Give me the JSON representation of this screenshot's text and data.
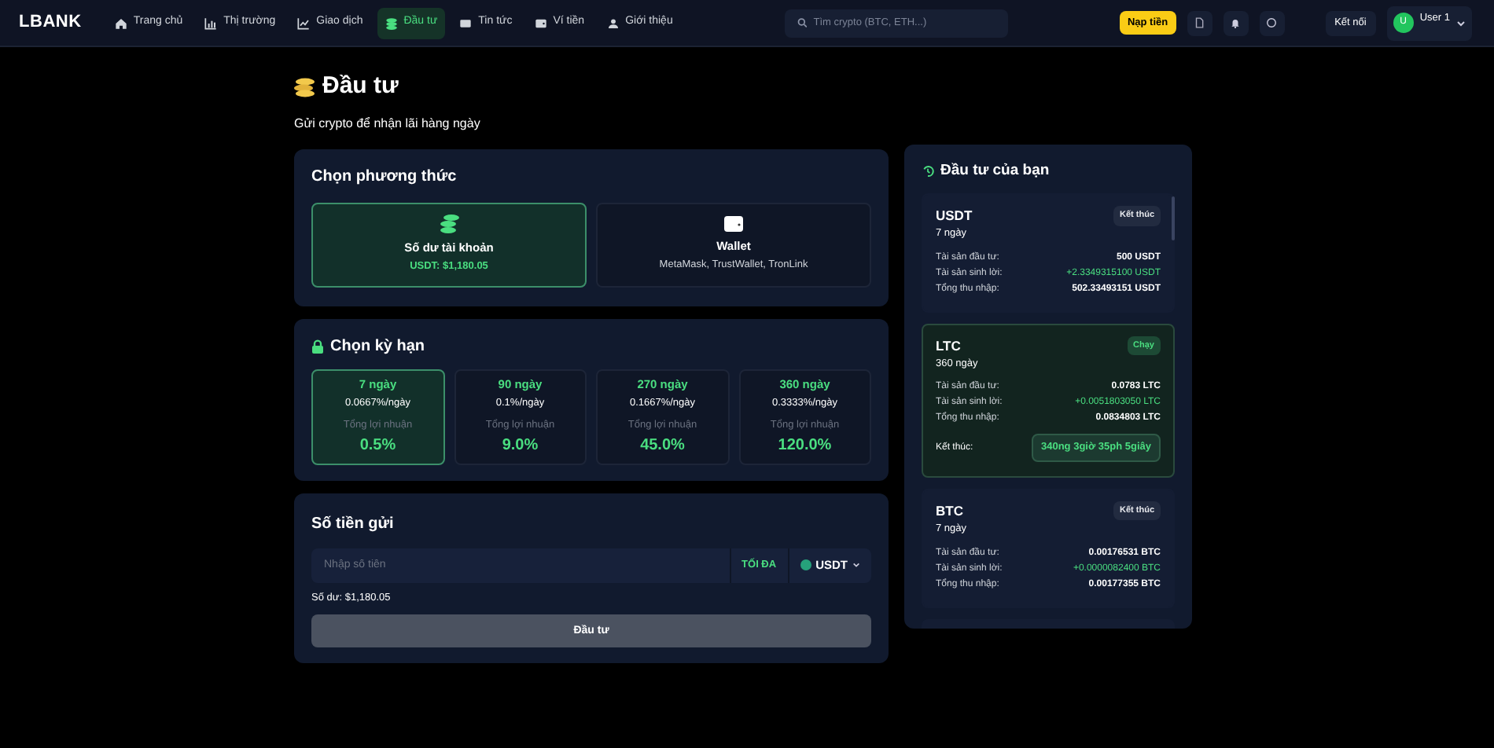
{
  "navbar": {
    "logo": "LBANK",
    "items": [
      {
        "label": "Trang chủ",
        "selected": false
      },
      {
        "label": "Thị trường",
        "selected": false
      },
      {
        "label": "Giao dịch",
        "selected": false
      },
      {
        "label": "Đầu tư",
        "selected": true
      },
      {
        "label": "Tin tức",
        "selected": false
      },
      {
        "label": "Ví tiền",
        "selected": false
      },
      {
        "label": "Giới thiệu",
        "selected": false
      }
    ],
    "search": {
      "placeholder": "Tìm crypto (BTC, ETH...)"
    },
    "deposit_button": "Nạp tiền",
    "connect_button": "Kết nối",
    "user": {
      "avatar": "U",
      "name": "User 1"
    }
  },
  "page": {
    "title": "Đầu tư",
    "subtitle": "Gửi crypto để nhận lãi hàng ngày"
  },
  "method_card": {
    "title": "Chọn phương thức",
    "options": [
      {
        "kind": "balance",
        "title": "Số dư tài khoản",
        "detail": "USDT: $1,180.05",
        "selected": true
      },
      {
        "kind": "wallet",
        "title": "Wallet",
        "detail": "MetaMask, TrustWallet, TronLink",
        "selected": false
      }
    ]
  },
  "term_card": {
    "title": "Chọn kỳ hạn",
    "terms": [
      {
        "duration": "7 ngày",
        "rate": "0.0667%/ngày",
        "profit_label": "Tổng lợi nhuận",
        "profit": "0.5%",
        "selected": true
      },
      {
        "duration": "90 ngày",
        "rate": "0.1%/ngày",
        "profit_label": "Tổng lợi nhuận",
        "profit": "9.0%",
        "selected": false
      },
      {
        "duration": "270 ngày",
        "rate": "0.1667%/ngày",
        "profit_label": "Tổng lợi nhuận",
        "profit": "45.0%",
        "selected": false
      },
      {
        "duration": "360 ngày",
        "rate": "0.3333%/ngày",
        "profit_label": "Tổng lợi nhuận",
        "profit": "120.0%",
        "selected": false
      }
    ]
  },
  "amount_card": {
    "title": "Số tiền gửi",
    "amount": {
      "placeholder": "Nhập số tiền"
    },
    "max_button": "TỐI ĐA",
    "currency": "USDT",
    "balance": "Số dư: $1,180.05",
    "submit_button": "Đầu tư"
  },
  "investments_panel": {
    "title": "Đầu tư của bạn",
    "investments": [
      {
        "coin": "USDT",
        "term": "7 ngày",
        "kind": "ended",
        "badge": "Kết thúc",
        "rows": [
          {
            "label": "Tài sản đầu tư:",
            "value": "500 USDT",
            "kind": "plain"
          },
          {
            "label": "Tài sản sinh lời:",
            "value": "+2.3349315100 USDT",
            "kind": "gain"
          },
          {
            "label": "Tổng thu nhập:",
            "value": "502.33493151 USDT",
            "kind": "plain"
          }
        ]
      },
      {
        "coin": "LTC",
        "term": "360 ngày",
        "kind": "running",
        "badge": "Chạy",
        "rows": [
          {
            "label": "Tài sản đầu tư:",
            "value": "0.0783 LTC",
            "kind": "plain"
          },
          {
            "label": "Tài sản sinh lời:",
            "value": "+0.0051803050 LTC",
            "kind": "gain"
          },
          {
            "label": "Tổng thu nhập:",
            "value": "0.0834803 LTC",
            "kind": "plain"
          }
        ],
        "end_label": "Kết thúc:",
        "countdown": "340ng 3giờ 35ph 5giây"
      },
      {
        "coin": "BTC",
        "term": "7 ngày",
        "kind": "ended",
        "badge": "Kết thúc",
        "rows": [
          {
            "label": "Tài sản đầu tư:",
            "value": "0.00176531 BTC",
            "kind": "plain"
          },
          {
            "label": "Tài sản sinh lời:",
            "value": "+0.0000082400 BTC",
            "kind": "gain"
          },
          {
            "label": "Tổng thu nhập:",
            "value": "0.00177355 BTC",
            "kind": "plain"
          }
        ]
      }
    ]
  }
}
